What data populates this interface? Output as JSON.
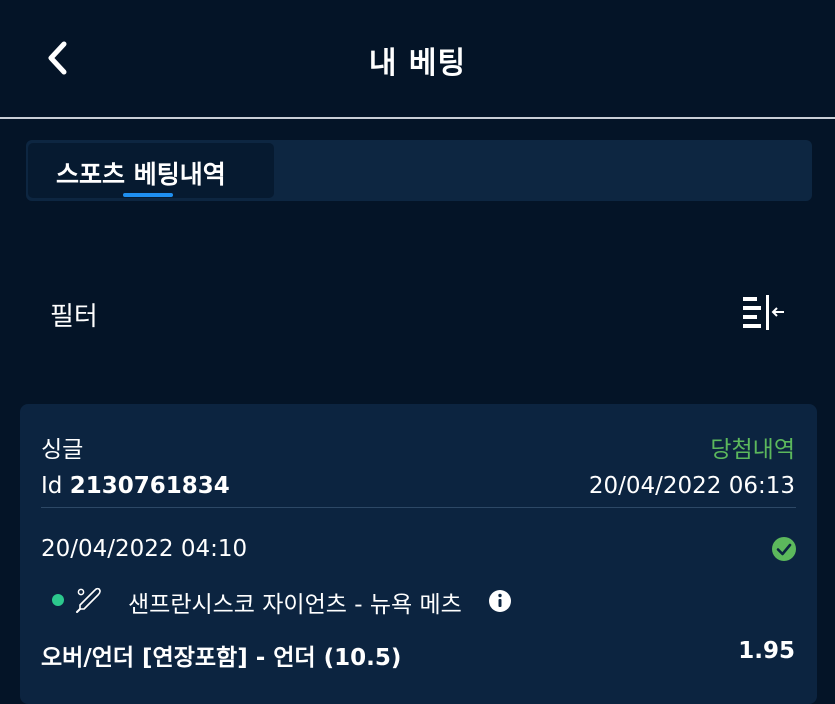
{
  "header": {
    "title": "내 베팅",
    "back_icon": "chevron-left-icon"
  },
  "tabs": [
    {
      "label": "스포츠 베팅내역",
      "active": true
    }
  ],
  "filter": {
    "label": "필터",
    "icon": "collapse-list-icon"
  },
  "bet": {
    "type": "싱글",
    "status": "당첨내역",
    "status_color": "#5cb85c",
    "id_prefix": "Id",
    "id": "2130761834",
    "placed_at": "20/04/2022 06:13",
    "event_date": "20/04/2022 04:10",
    "result_icon": "check-circle-icon",
    "live_dot_color": "#2cc88d",
    "sport_icon": "baseball-bat-icon",
    "event_name": "샌프란시스코 자이언츠 - 뉴욕 메츠",
    "market": "오버/언더 [연장포함] - 언더 (10.5)",
    "odds": "1.95"
  },
  "colors": {
    "background": "#041427",
    "card": "#0c2440",
    "tab_bar": "#0d2641",
    "accent": "#1f8ff0"
  }
}
